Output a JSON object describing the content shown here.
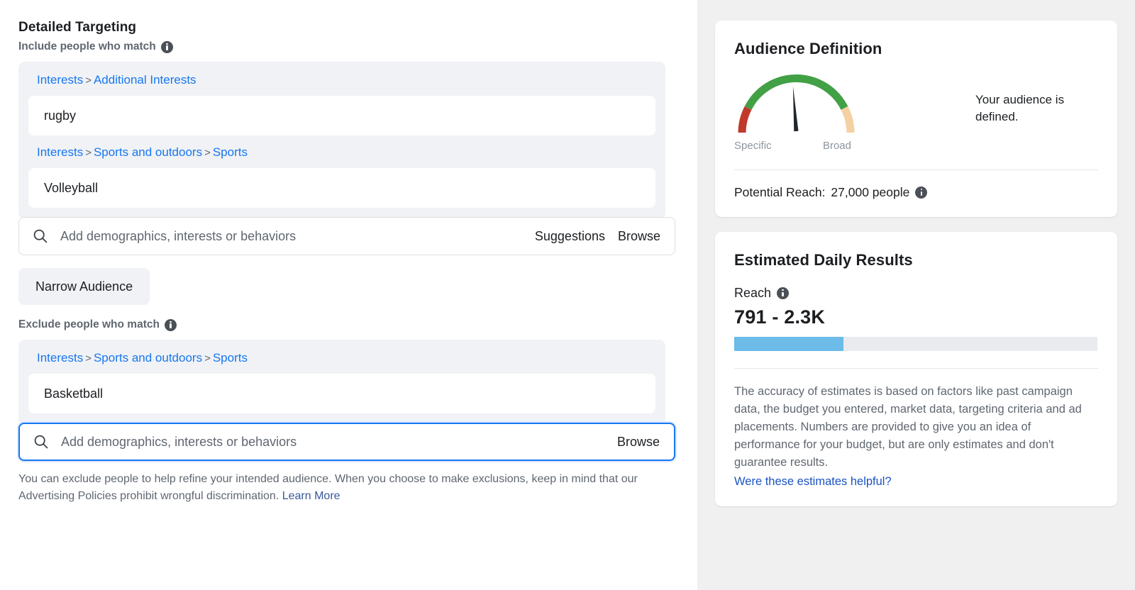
{
  "left_panel": {
    "section_title": "Detailed Targeting",
    "include_label": "Include people who match",
    "include_info_icon": "info-icon",
    "include_groups": [
      {
        "breadcrumb": [
          {
            "label": "Interests",
            "link": true
          },
          {
            "label": ">",
            "link": false
          },
          {
            "label": "Additional Interests",
            "link": true
          }
        ],
        "value": "rugby"
      },
      {
        "breadcrumb": [
          {
            "label": "Interests",
            "link": true
          },
          {
            "label": ">",
            "link": false
          },
          {
            "label": "Sports and outdoors",
            "link": true
          },
          {
            "label": ">",
            "link": false
          },
          {
            "label": "Sports",
            "link": true
          }
        ],
        "value": "Volleyball"
      }
    ],
    "include_search": {
      "icon": "search-icon",
      "placeholder": "Add demographics, interests or behaviors",
      "actions": [
        "Suggestions",
        "Browse"
      ]
    },
    "narrow_audience_button": "Narrow Audience",
    "exclude_label": "Exclude people who match",
    "exclude_info_icon": "info-icon",
    "exclude_group": {
      "breadcrumb": [
        {
          "label": "Interests",
          "link": true
        },
        {
          "label": ">",
          "link": false
        },
        {
          "label": "Sports and outdoors",
          "link": true
        },
        {
          "label": ">",
          "link": false
        },
        {
          "label": "Sports",
          "link": true
        }
      ],
      "value": "Basketball"
    },
    "exclude_search": {
      "icon": "search-icon",
      "placeholder": "Add demographics, interests or behaviors",
      "actions": [
        "Browse"
      ],
      "focused": true
    },
    "disclaimer_text": "You can exclude people to help refine your intended audience. When you choose to make exclusions, keep in mind that our Advertising Policies prohibit wrongful discrimination.",
    "disclaimer_link": "Learn More"
  },
  "audience_definition": {
    "title": "Audience Definition",
    "gauge": {
      "left_label": "Specific",
      "right_label": "Broad",
      "needle_angle_deg": -4,
      "segments": [
        {
          "name": "specific",
          "color": "#c0392b",
          "start_deg": 180,
          "end_deg": 158
        },
        {
          "name": "defined",
          "color": "#42a045",
          "start_deg": 158,
          "end_deg": 22
        },
        {
          "name": "broad",
          "color": "#f5d0a0",
          "start_deg": 22,
          "end_deg": 0
        }
      ]
    },
    "status_message": "Your audience is defined.",
    "potential_reach_label": "Potential Reach:",
    "potential_reach_value": "27,000 people",
    "potential_reach_info_icon": "info-icon"
  },
  "estimated_daily_results": {
    "title": "Estimated Daily Results",
    "metric_label": "Reach",
    "metric_info_icon": "info-icon",
    "metric_value": "791 - 2.3K",
    "bar_fill_percent": 30,
    "bar_fill_color": "#6cbbe8",
    "bar_track_color": "#e9ebee",
    "body_text": "The accuracy of estimates is based on factors like past campaign data, the budget you entered, market data, targeting criteria and ad placements. Numbers are provided to give you an idea of performance for your budget, but are only estimates and don't guarantee results.",
    "feedback_link": "Were these estimates helpful?"
  },
  "colors": {
    "link_blue": "#1877f2",
    "dark_link_blue": "#385898",
    "panel_bg": "#f0f0f0",
    "group_bg": "#f0f2f5",
    "muted_text": "#606770"
  }
}
